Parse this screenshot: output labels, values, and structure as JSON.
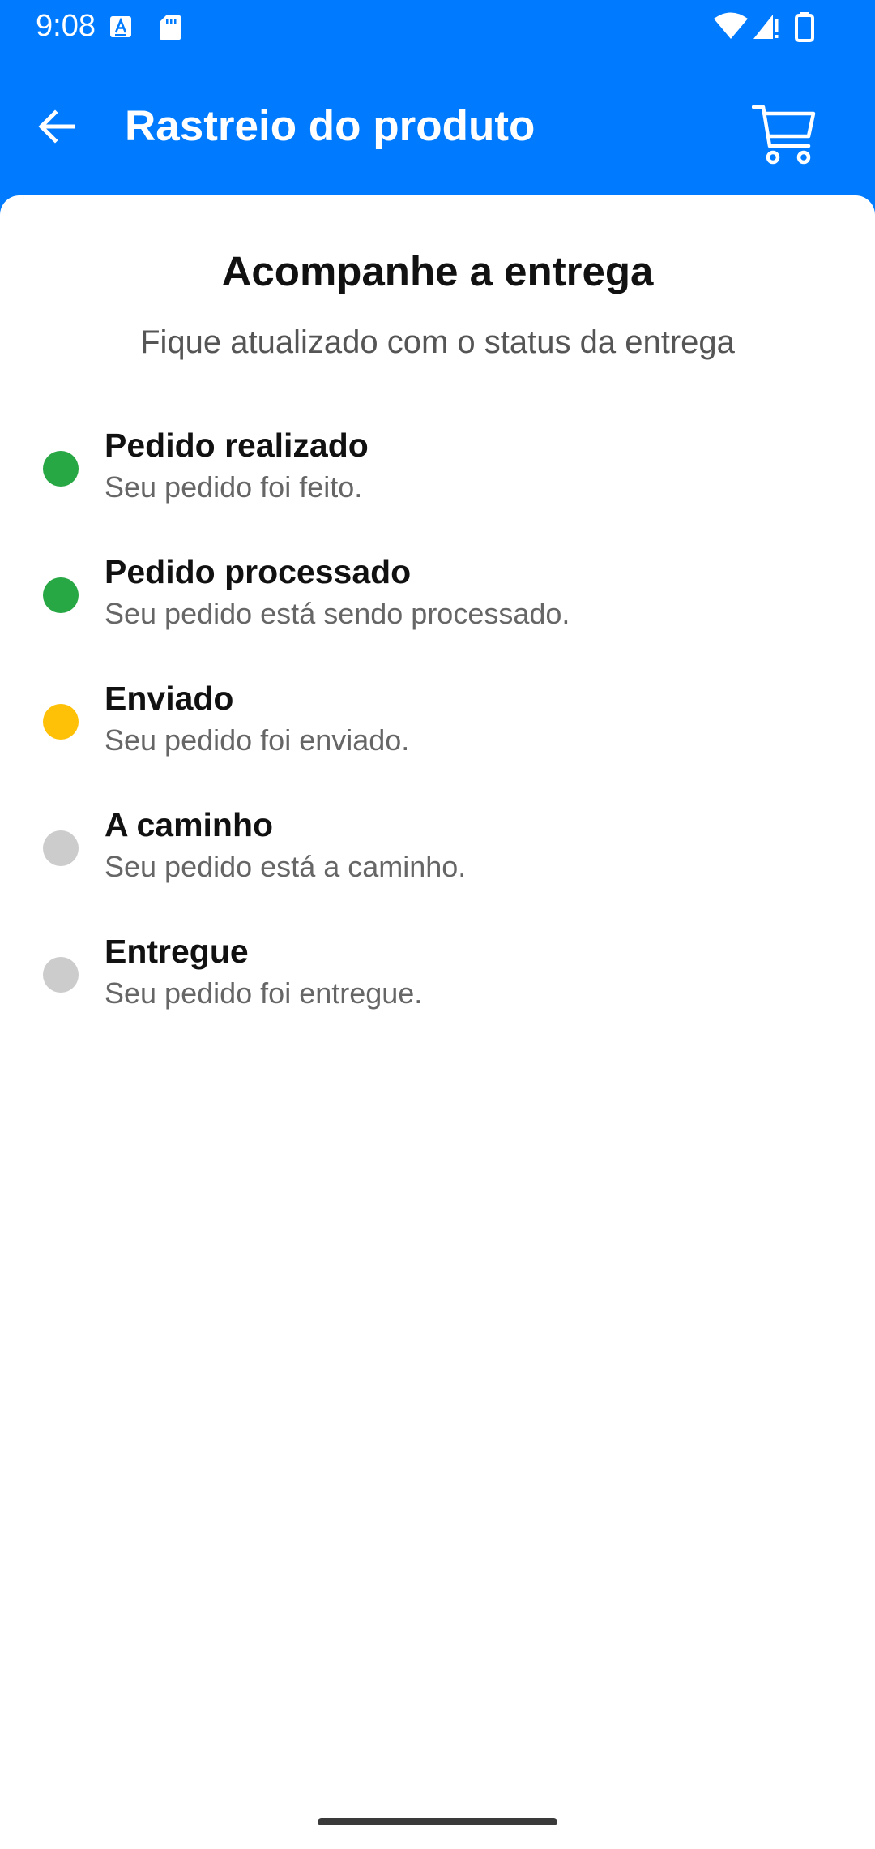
{
  "status_bar": {
    "time": "9:08"
  },
  "app_bar": {
    "title": "Rastreio do produto",
    "back_icon": "arrow-left-icon",
    "cart_icon": "cart-icon"
  },
  "main": {
    "heading": "Acompanhe a entrega",
    "subheading": "Fique atualizado com o status da entrega",
    "steps": [
      {
        "title": "Pedido realizado",
        "description": "Seu pedido foi feito.",
        "color": "#28A745"
      },
      {
        "title": "Pedido processado",
        "description": "Seu pedido está sendo processado.",
        "color": "#28A745"
      },
      {
        "title": "Enviado",
        "description": "Seu pedido foi enviado.",
        "color": "#FFC107"
      },
      {
        "title": "A caminho",
        "description": "Seu pedido está a caminho.",
        "color": "#CCCCCC"
      },
      {
        "title": "Entregue",
        "description": "Seu pedido foi entregue.",
        "color": "#CCCCCC"
      }
    ]
  },
  "colors": {
    "primary": "#007BFF",
    "completed": "#28A745",
    "current": "#FFC107",
    "pending": "#CCCCCC"
  }
}
